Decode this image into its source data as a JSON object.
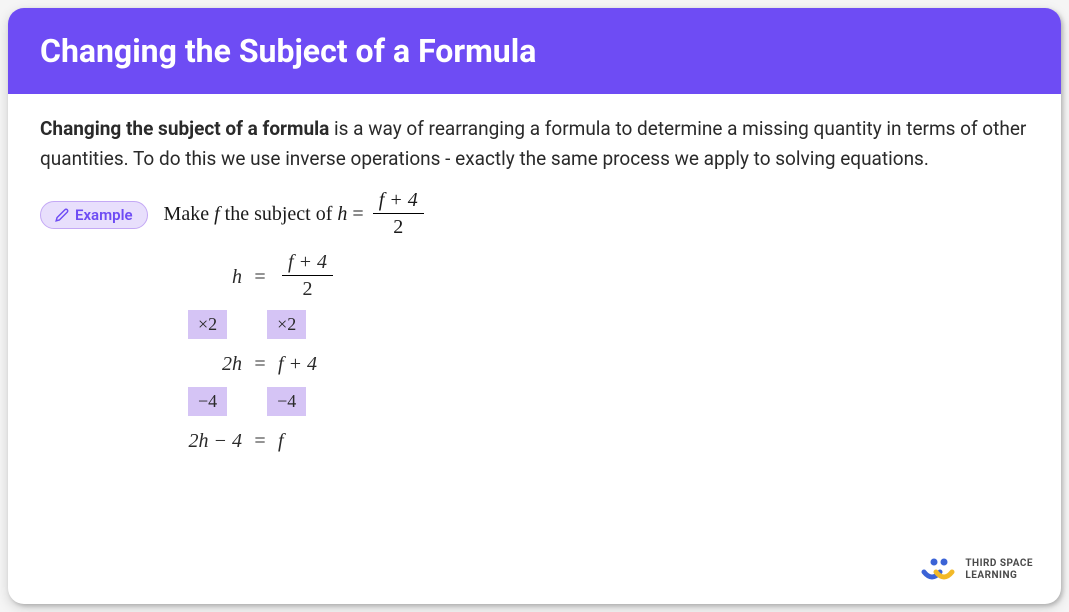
{
  "header": {
    "title": "Changing the Subject of a Formula"
  },
  "description": {
    "bold": "Changing the subject of a formula",
    "rest": " is a way of rearranging a formula to determine a missing quantity in terms of other quantities. To do this we use inverse operations - exactly the same process we apply to solving equations."
  },
  "example": {
    "badge": "Example",
    "prompt_pre": "Make ",
    "prompt_var": "f",
    "prompt_mid": " the subject of ",
    "prompt_lhs": "h",
    "prompt_eq": " = ",
    "prompt_num": "f + 4",
    "prompt_den": "2"
  },
  "working": {
    "line1_lhs": "h",
    "line1_eq": "=",
    "line1_num": "f + 4",
    "line1_den": "2",
    "op1_left": "×2",
    "op1_right": "×2",
    "line2_lhs": "2h",
    "line2_eq": "=",
    "line2_rhs": "f + 4",
    "op2_left": "−4",
    "op2_right": "−4",
    "line3_lhs": "2h − 4",
    "line3_eq": "=",
    "line3_rhs": "f"
  },
  "logo": {
    "text1": "THIRD SPACE",
    "text2": "LEARNING"
  }
}
